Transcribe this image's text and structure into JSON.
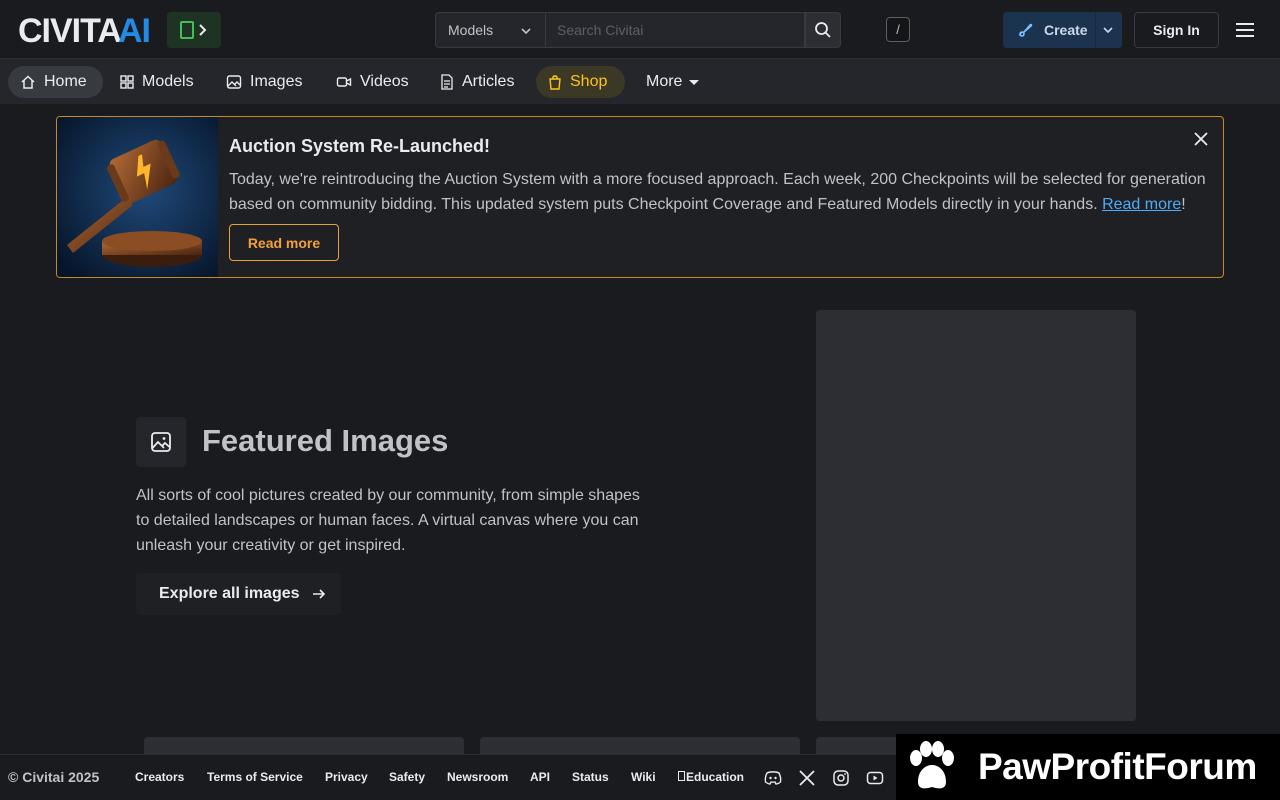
{
  "header": {
    "logo_text": "CIVITAI",
    "search": {
      "category": "Models",
      "placeholder": "Search Civitai",
      "shortcut": "/"
    },
    "create_label": "Create",
    "signin_label": "Sign In"
  },
  "nav": {
    "items": [
      {
        "label": "Home",
        "icon": "home-icon"
      },
      {
        "label": "Models",
        "icon": "grid-icon"
      },
      {
        "label": "Images",
        "icon": "photo-icon"
      },
      {
        "label": "Videos",
        "icon": "video-icon"
      },
      {
        "label": "Articles",
        "icon": "file-text-icon"
      },
      {
        "label": "Shop",
        "icon": "shopping-bag-icon"
      },
      {
        "label": "More",
        "icon": "caret-down-icon"
      }
    ]
  },
  "banner": {
    "title": "Auction System Re-Launched!",
    "text": "Today, we're reintroducing the Auction System with a more focused approach. Each week, 200 Checkpoints will be selected for generation based on community bidding. This updated system puts Checkpoint Coverage and Featured Models directly in your hands. ",
    "link_label": "Read more",
    "link_suffix": "!",
    "button_label": "Read more"
  },
  "featured": {
    "title": "Featured Images",
    "description": "All sorts of cool pictures created by our community, from simple shapes to detailed landscapes or human faces. A virtual canvas where you can unleash your creativity or get inspired.",
    "button_label": "Explore all images"
  },
  "footer": {
    "copyright": "© Civitai 2025",
    "links": [
      "Creators",
      "Terms of Service",
      "Privacy",
      "Safety",
      "Newsroom",
      "API",
      "Status",
      "Wiki",
      "Education"
    ],
    "social_icons": [
      "discord-icon",
      "x-icon",
      "instagram-icon",
      "youtube-icon"
    ]
  },
  "watermark": {
    "text": "PawProfitForum"
  },
  "colors": {
    "background": "#1a1b1e",
    "accent_blue": "#4dabf7",
    "banner_border": "#c9872b",
    "shop_yellow": "#fcc419"
  }
}
